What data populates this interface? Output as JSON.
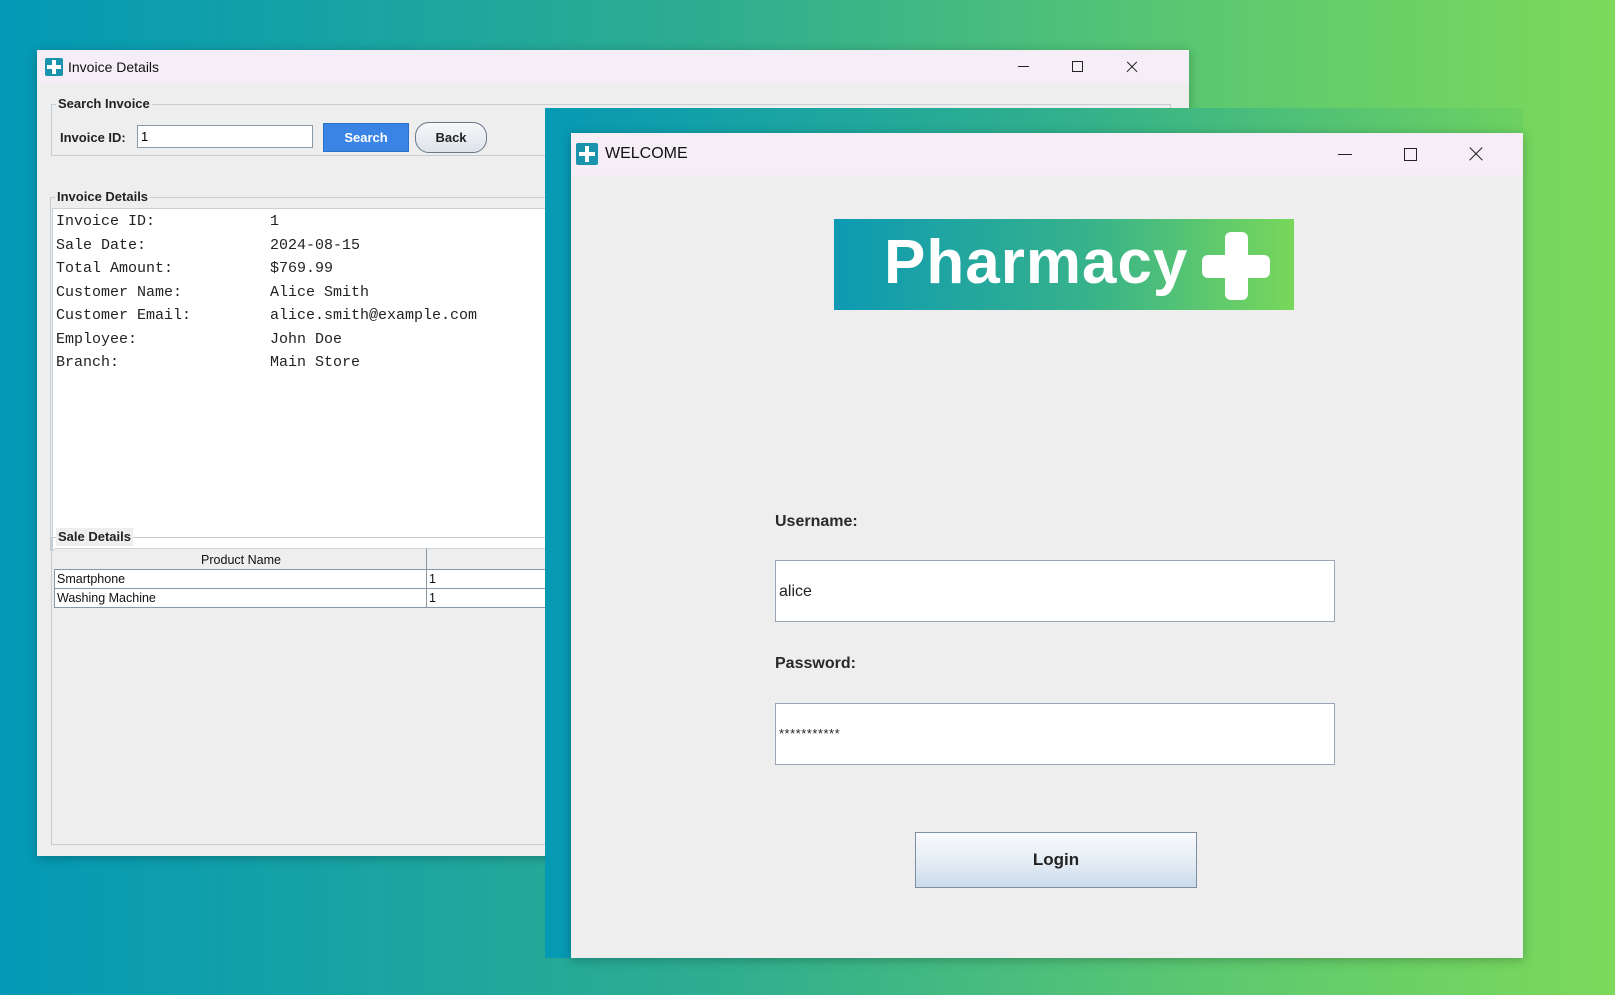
{
  "invoice_window": {
    "title": "Invoice Details",
    "search_group": {
      "title": "Search Invoice",
      "invoice_id_label": "Invoice ID:",
      "invoice_id_value": "1",
      "search_label": "Search",
      "back_label": "Back"
    },
    "details_group": {
      "title": "Invoice Details",
      "rows": [
        {
          "key": "Invoice ID:",
          "value": "1"
        },
        {
          "key": "Sale Date:",
          "value": "2024-08-15"
        },
        {
          "key": "Total Amount:",
          "value": "$769.99"
        },
        {
          "key": "Customer Name:",
          "value": "Alice Smith"
        },
        {
          "key": "Customer Email:",
          "value": "alice.smith@example.com"
        },
        {
          "key": "Employee:",
          "value": "John Doe"
        },
        {
          "key": "Branch:",
          "value": "Main Store"
        }
      ]
    },
    "sale_group": {
      "title": "Sale Details",
      "columns": [
        "Product Name",
        ""
      ],
      "rows": [
        [
          "Smartphone",
          "1"
        ],
        [
          "Washing Machine",
          "1"
        ]
      ]
    }
  },
  "welcome_window": {
    "title": "WELCOME",
    "logo_text": "Pharmacy",
    "username_label": "Username:",
    "username_value": "alice",
    "password_label": "Password:",
    "password_value": "***********",
    "login_label": "Login"
  },
  "colors": {
    "accent_blue": "#3a84e6",
    "logo_gradient_start": "#0d9ab3",
    "logo_gradient_end": "#78d75a",
    "app_icon": "#1a93ad"
  }
}
